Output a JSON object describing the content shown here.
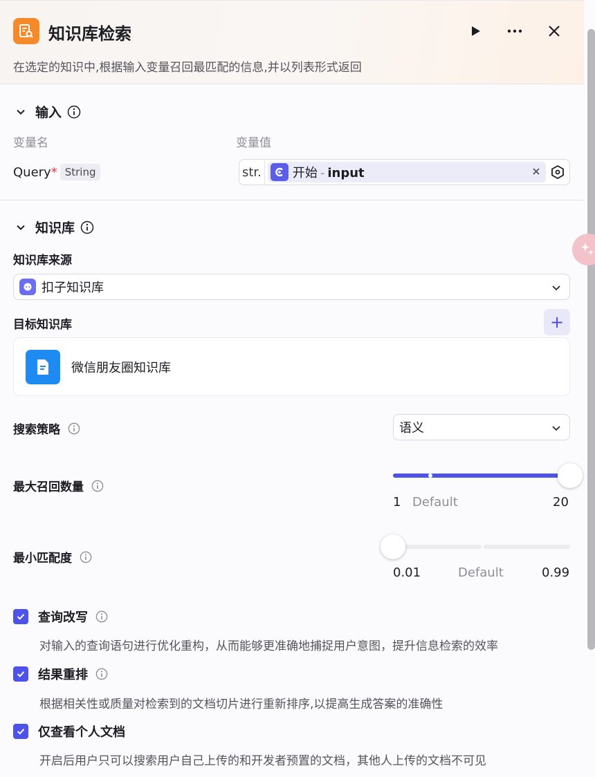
{
  "header": {
    "title": "知识库检索",
    "description": "在选定的知识中,根据输入变量召回最匹配的信息,并以列表形式返回"
  },
  "input_section": {
    "title": "输入",
    "col_name_label": "变量名",
    "col_value_label": "变量值",
    "variable": {
      "name": "Query",
      "required_mark": "*",
      "type": "String",
      "value_type_prefix": "str.",
      "source_node": "开始",
      "separator": "-",
      "source_var": "input"
    }
  },
  "kb_section": {
    "title": "知识库",
    "source_label": "知识库来源",
    "source_value": "扣子知识库",
    "target_label": "目标知识库",
    "add_label": "+",
    "knowledge_bases": [
      {
        "name": "微信朋友圈知识库"
      }
    ],
    "search_strategy_label": "搜索策略",
    "search_strategy_value": "语义",
    "max_recall": {
      "label": "最大召回数量",
      "min": "1",
      "default_label": "Default",
      "max": "20",
      "value": 20
    },
    "min_match": {
      "label": "最小匹配度",
      "min": "0.01",
      "default_label": "Default",
      "max": "0.99",
      "value": 0.01
    },
    "options": [
      {
        "label": "查询改写",
        "checked": true,
        "description": "对输入的查询语句进行优化重构，从而能够更准确地捕捉用户意图，提升信息检索的效率",
        "has_info": true
      },
      {
        "label": "结果重排",
        "checked": true,
        "description": "根据相关性或质量对检索到的文档切片进行重新排序,以提高生成答案的准确性",
        "has_info": true
      },
      {
        "label": "仅查看个人文档",
        "checked": true,
        "description": "开启后用户只可以搜索用户自己上传的和开发者预置的文档，其他人上传的文档不可见",
        "has_info": false
      }
    ]
  },
  "colors": {
    "accent": "#4d53e8",
    "node_icon": "#f58a2b",
    "kb_icon": "#1e8bf3"
  }
}
